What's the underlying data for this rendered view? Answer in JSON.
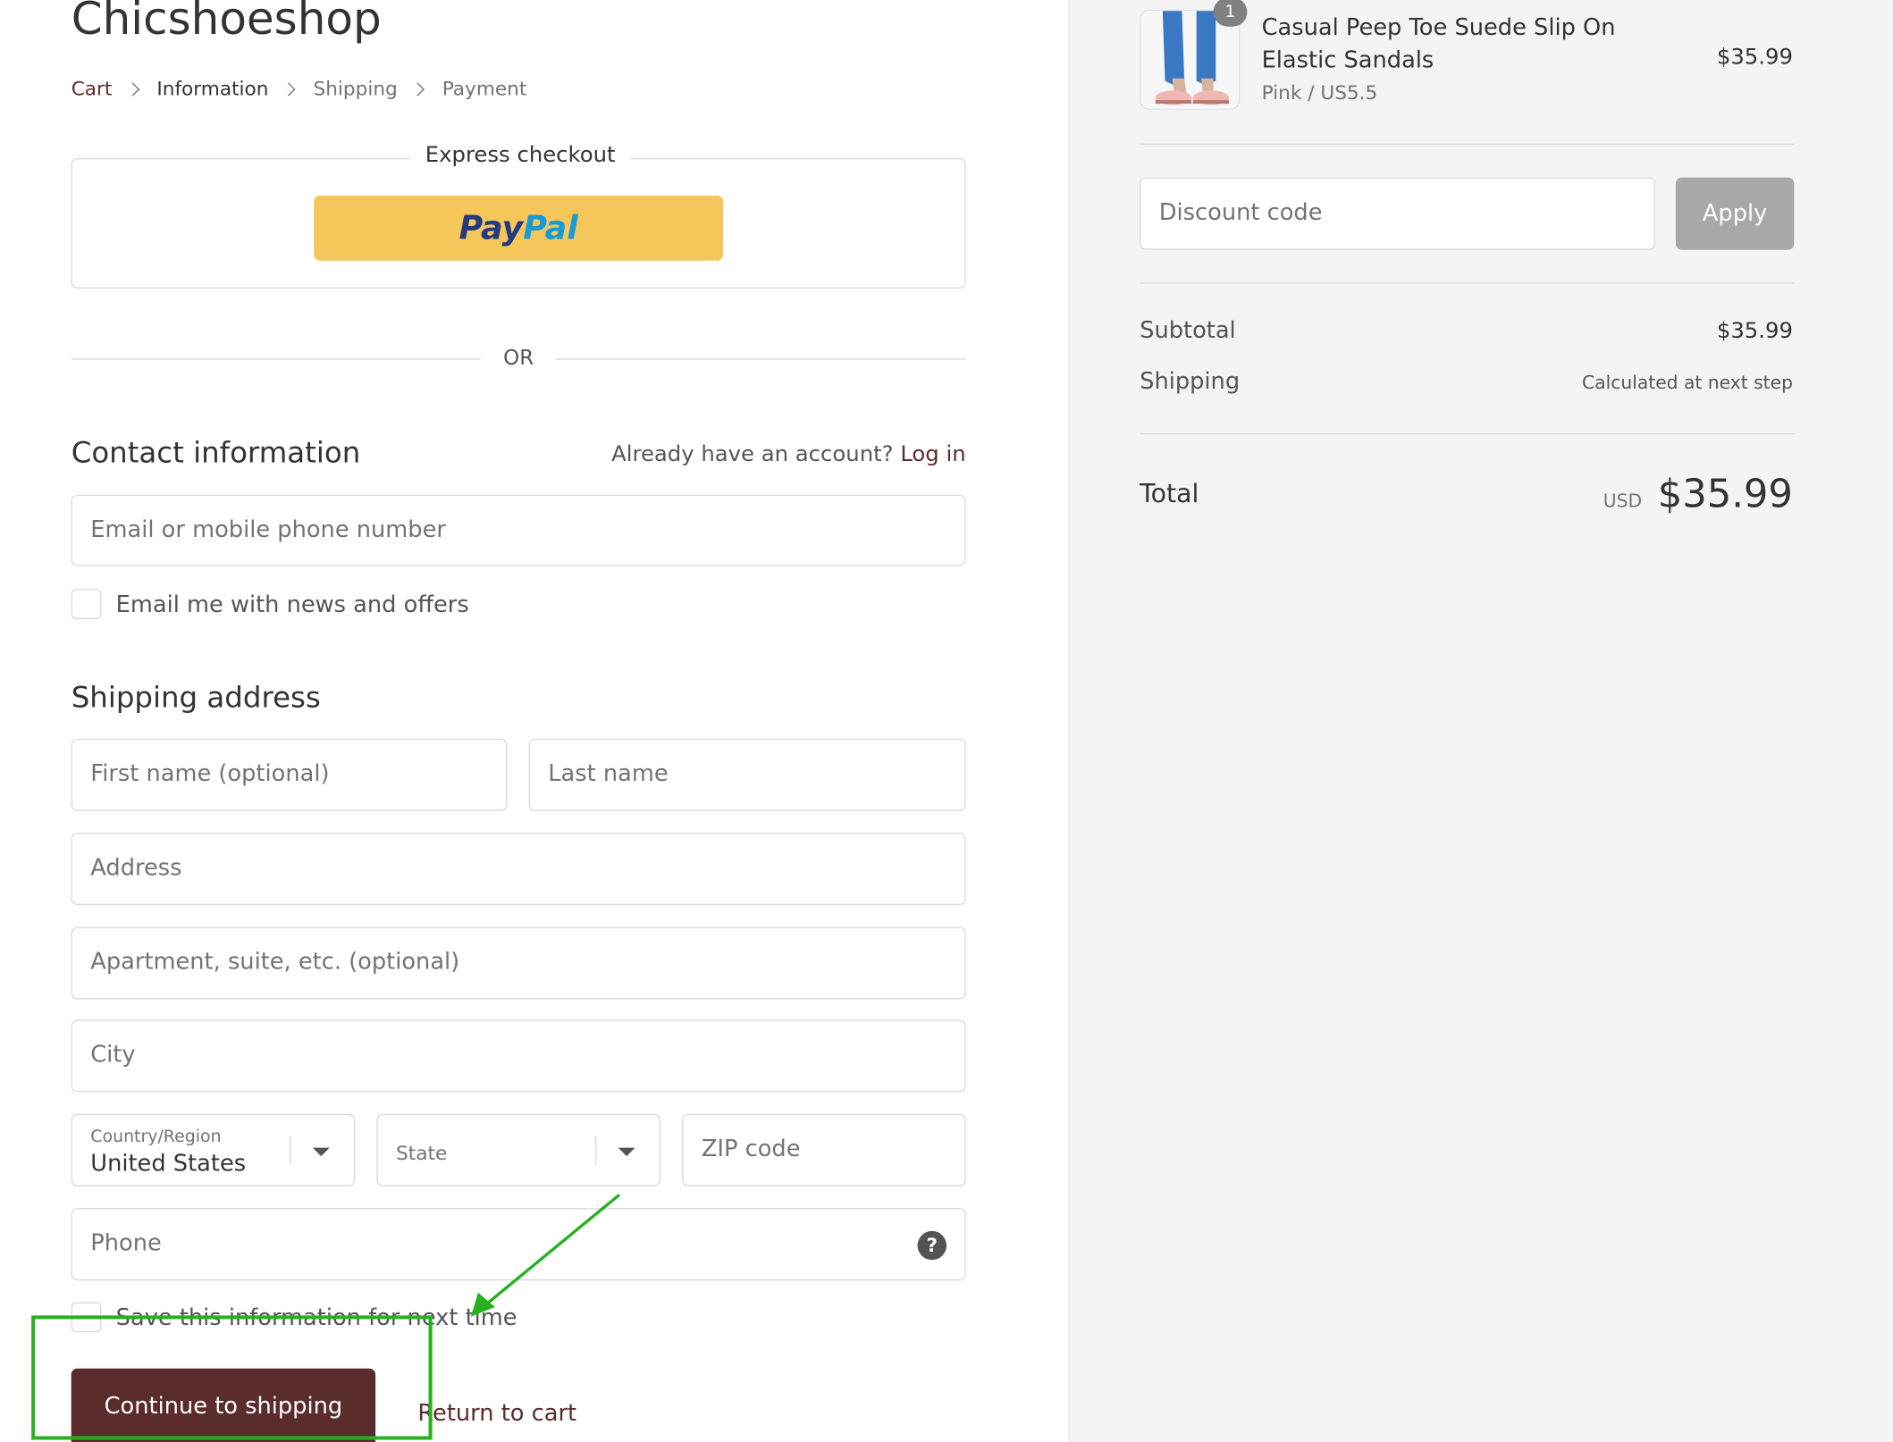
{
  "store": {
    "title": "Chicshoeshop"
  },
  "breadcrumb": [
    {
      "label": "Cart"
    },
    {
      "label": "Information"
    },
    {
      "label": "Shipping"
    },
    {
      "label": "Payment"
    }
  ],
  "express": {
    "title": "Express checkout",
    "paypal_part1": "Pay",
    "paypal_part2": "Pal"
  },
  "divider": {
    "or": "OR"
  },
  "contact": {
    "title": "Contact information",
    "account_prompt": "Already have an account?",
    "login_label": "Log in",
    "email_placeholder": "Email or mobile phone number",
    "newsletter_label": "Email me with news and offers"
  },
  "shipping_address": {
    "title": "Shipping address",
    "first_name_placeholder": "First name (optional)",
    "last_name_placeholder": "Last name",
    "address_placeholder": "Address",
    "apartment_placeholder": "Apartment, suite, etc. (optional)",
    "city_placeholder": "City",
    "country_label": "Country/Region",
    "country_value": "United States",
    "state_placeholder": "State",
    "zip_placeholder": "ZIP code",
    "phone_placeholder": "Phone",
    "save_info_label": "Save this information for next time"
  },
  "actions": {
    "continue_label": "Continue to shipping",
    "return_label": "Return to cart"
  },
  "order": {
    "quantity": "1",
    "product_name": "Casual Peep Toe Suede Slip On Elastic Sandals",
    "variant": "Pink / US5.5",
    "price": "$35.99",
    "discount_placeholder": "Discount code",
    "apply_label": "Apply",
    "subtotal_label": "Subtotal",
    "subtotal_value": "$35.99",
    "shipping_label": "Shipping",
    "shipping_value": "Calculated at next step",
    "total_label": "Total",
    "total_currency": "USD",
    "total_value": "$35.99"
  },
  "colors": {
    "primary_button": "#5b2c2c",
    "paypal_button": "#f5c65a",
    "annotation": "#28b020",
    "apply_button": "#a8a8a8"
  }
}
